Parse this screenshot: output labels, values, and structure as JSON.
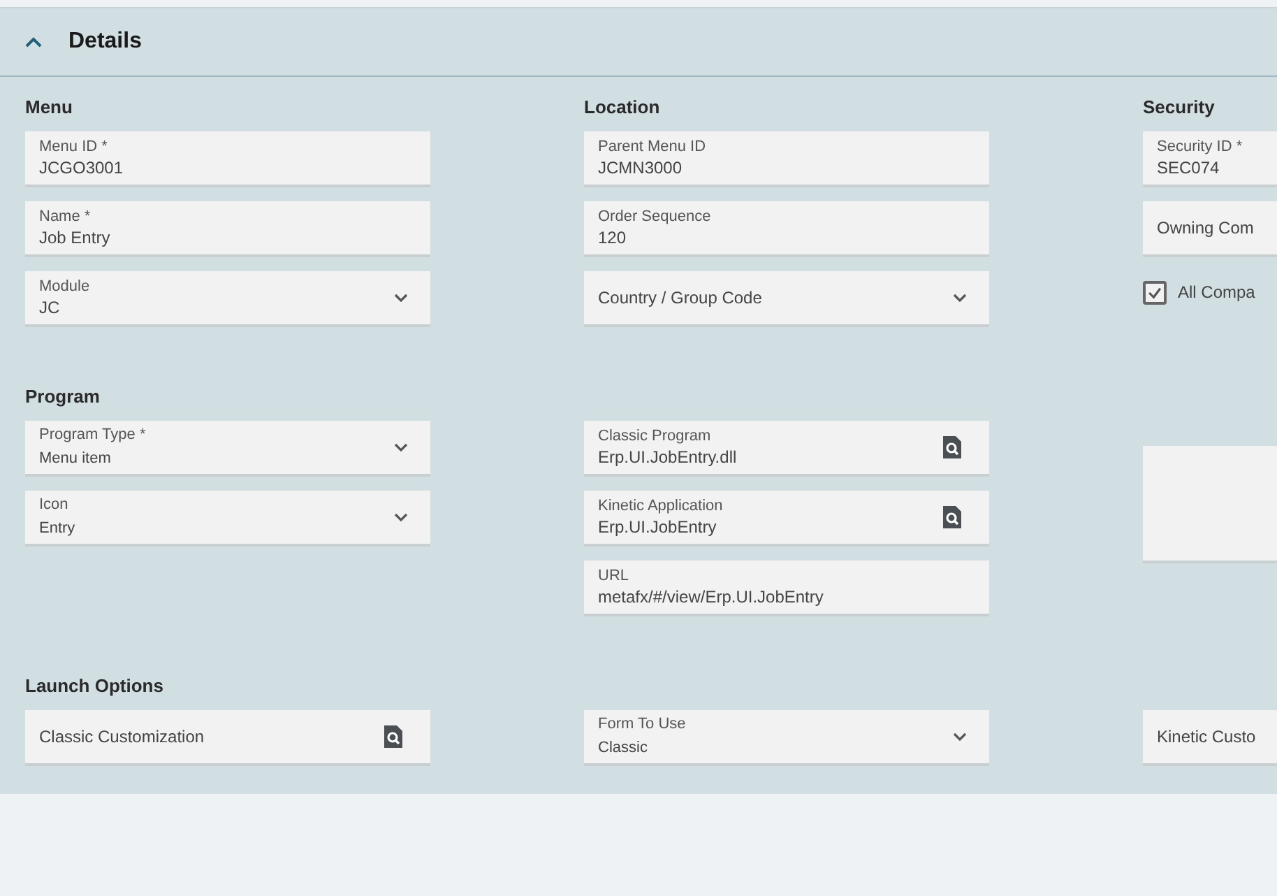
{
  "panel": {
    "title": "Details",
    "expanded": true
  },
  "sections": [
    {
      "columns": [
        {
          "heading": "Menu",
          "fields": [
            {
              "kind": "text",
              "label": "Menu ID *",
              "value": "JCGO3001"
            },
            {
              "kind": "text",
              "label": "Name *",
              "value": "Job Entry"
            },
            {
              "kind": "select",
              "label": "Module",
              "value": "JC"
            }
          ]
        },
        {
          "heading": "Location",
          "fields": [
            {
              "kind": "text",
              "label": "Parent Menu ID",
              "value": "JCMN3000"
            },
            {
              "kind": "text",
              "label": "Order Sequence",
              "value": "120"
            },
            {
              "kind": "select",
              "placeholder": "Country / Group Code"
            }
          ]
        },
        {
          "heading": "Security",
          "fields": [
            {
              "kind": "text",
              "label": "Security ID *",
              "value": "SEC074"
            },
            {
              "kind": "text",
              "placeholder": "Owning Com"
            },
            {
              "kind": "checkbox",
              "label": "All Compa",
              "checked": true
            }
          ]
        }
      ]
    },
    {
      "columns": [
        {
          "heading": "Program",
          "fields": [
            {
              "kind": "select",
              "label": "Program Type *",
              "value": "Menu item",
              "small": true
            },
            {
              "kind": "select",
              "label": "Icon",
              "value": "Entry",
              "small": true
            }
          ]
        },
        {
          "fields": [
            {
              "kind": "lookup",
              "label": "Classic Program",
              "value": "Erp.UI.JobEntry.dll"
            },
            {
              "kind": "lookup",
              "label": "Kinetic Application",
              "value": "Erp.UI.JobEntry"
            },
            {
              "kind": "text",
              "label": "URL",
              "value": "metafx/#/view/Erp.UI.JobEntry"
            }
          ]
        },
        {
          "fields": [
            {
              "kind": "blank"
            }
          ]
        }
      ]
    },
    {
      "columns": [
        {
          "heading": "Launch Options",
          "fields": [
            {
              "kind": "lookup",
              "placeholder": "Classic Customization"
            }
          ]
        },
        {
          "fields": [
            {
              "kind": "select",
              "label": "Form To Use",
              "value": "Classic",
              "small": true
            }
          ]
        },
        {
          "fields": [
            {
              "kind": "text",
              "placeholder": "Kinetic Custo"
            }
          ]
        }
      ]
    }
  ]
}
